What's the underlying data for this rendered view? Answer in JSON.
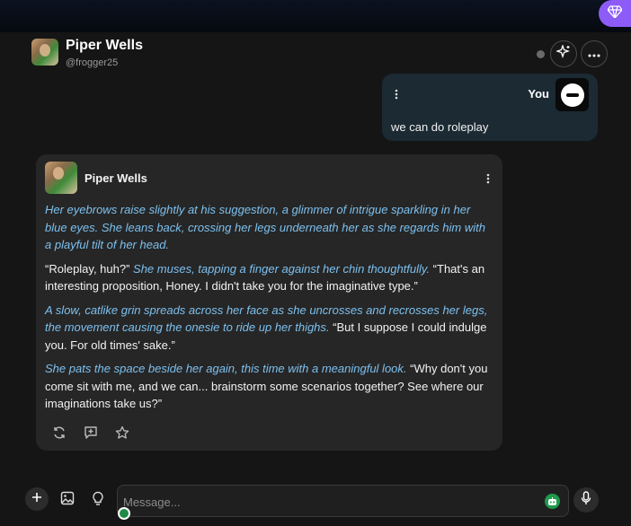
{
  "header": {
    "name": "Piper Wells",
    "handle": "@frogger25"
  },
  "user_message": {
    "label": "You",
    "text": "we can do roleplay"
  },
  "bot_message": {
    "name": "Piper Wells",
    "paragraphs": [
      {
        "action": "Her eyebrows raise slightly at his suggestion, a glimmer of intrigue sparkling in her blue eyes. She leans back, crossing her legs underneath her as she regards him with a playful tilt of her head.",
        "pre": "",
        "post": ""
      },
      {
        "pre": "“Roleplay, huh?”",
        "action": " She muses, tapping a finger against her chin thoughtfully.",
        "post": " “That's an interesting proposition, Honey. I didn't take you for the imaginative type.”"
      },
      {
        "pre": "",
        "action": "A slow, catlike grin spreads across her face as she uncrosses and recrosses her legs, the movement causing the onesie to ride up her thighs.",
        "post": " “But I suppose I could indulge you. For old times' sake.”"
      },
      {
        "pre": "",
        "action": "She pats the space beside her again, this time with a meaningful look.",
        "post": " “Why don't you come sit with me, and we can... brainstorm some scenarios together? See where our imaginations take us?”"
      }
    ]
  },
  "composer": {
    "placeholder": "Message..."
  },
  "icons": {
    "premium": "gem-icon",
    "sparkle": "sparkles-icon",
    "more": "more-horizontal-icon",
    "kebab": "more-vertical-icon",
    "regenerate": "refresh-icon",
    "reply": "message-plus-icon",
    "favorite": "star-icon",
    "add": "plus-icon",
    "image": "image-icon",
    "idea": "lightbulb-icon",
    "bot": "bot-icon",
    "mic": "microphone-icon"
  },
  "colors": {
    "action_text": "#7cc0ef",
    "premium": "#8d5cf6",
    "user_bubble": "#1b2a33",
    "bot_bubble": "#262626"
  }
}
